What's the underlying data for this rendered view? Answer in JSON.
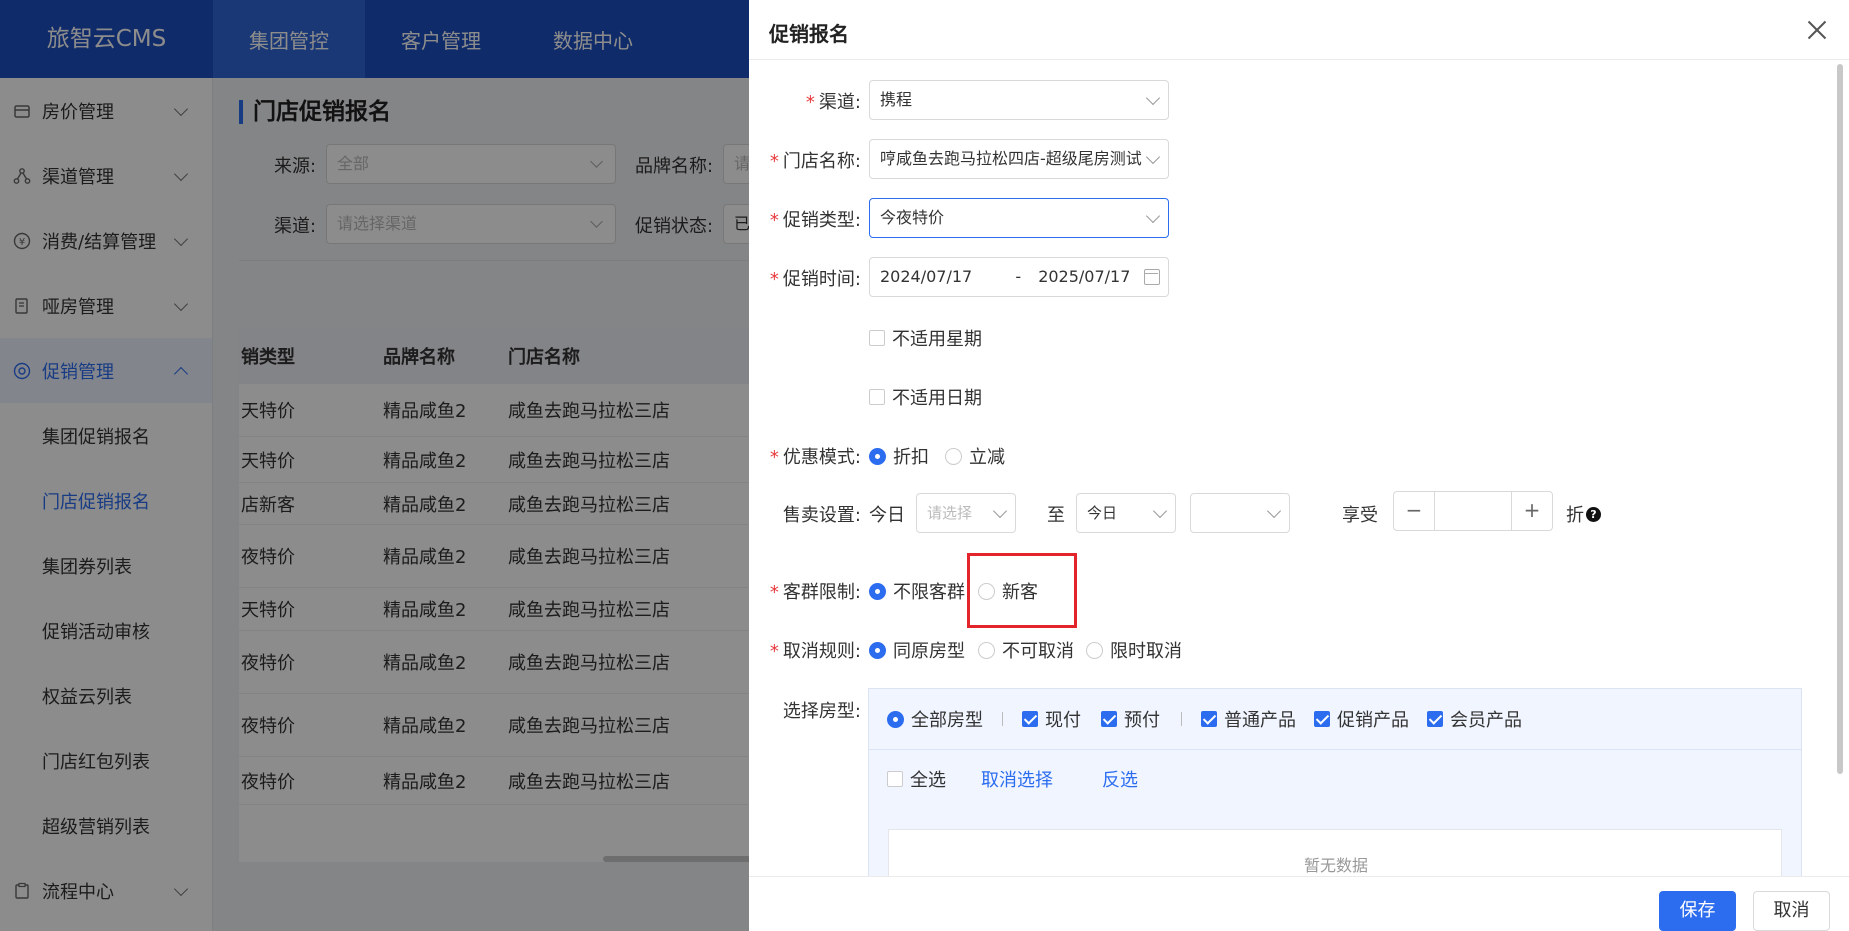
{
  "app": {
    "logo": "旅智云CMS"
  },
  "topnav": [
    "集团管控",
    "客户管理",
    "数据中心"
  ],
  "sidebar": {
    "items": [
      {
        "label": "房价管理"
      },
      {
        "label": "渠道管理"
      },
      {
        "label": "消费/结算管理"
      },
      {
        "label": "哑房管理"
      },
      {
        "label": "促销管理"
      }
    ],
    "sub_items": [
      "集团促销报名",
      "门店促销报名",
      "集团券列表",
      "促销活动审核",
      "权益云列表",
      "门店红包列表",
      "超级营销列表"
    ],
    "last_item": {
      "label": "流程中心"
    }
  },
  "main": {
    "title": "门店促销报名",
    "filters": {
      "source_label": "来源:",
      "source_value": "全部",
      "brand_label": "品牌名称:",
      "brand_value": "请",
      "channel_label": "渠道:",
      "channel_placeholder": "请选择渠道",
      "status_label": "促销状态:",
      "status_value": "已"
    },
    "table": {
      "headers": [
        "销类型",
        "品牌名称",
        "门店名称"
      ],
      "rows": [
        [
          "天特价",
          "精品咸鱼2",
          "咸鱼去跑马拉松三店"
        ],
        [
          "天特价",
          "精品咸鱼2",
          "咸鱼去跑马拉松三店"
        ],
        [
          "店新客",
          "精品咸鱼2",
          "咸鱼去跑马拉松三店"
        ],
        [
          "夜特价",
          "精品咸鱼2",
          "咸鱼去跑马拉松三店"
        ],
        [
          "天特价",
          "精品咸鱼2",
          "咸鱼去跑马拉松三店"
        ],
        [
          "夜特价",
          "精品咸鱼2",
          "咸鱼去跑马拉松三店"
        ],
        [
          "夜特价",
          "精品咸鱼2",
          "咸鱼去跑马拉松三店"
        ],
        [
          "夜特价",
          "精品咸鱼2",
          "咸鱼去跑马拉松三店"
        ]
      ]
    }
  },
  "drawer": {
    "title": "促销报名",
    "required_mark": "*",
    "channel": {
      "label": "渠道:",
      "value": "携程"
    },
    "store": {
      "label": "门店名称:",
      "value": "哼咸鱼去跑马拉松四店-超级尾房测试"
    },
    "promo_type": {
      "label": "促销类型:",
      "value": "今夜特价"
    },
    "promo_time": {
      "label": "促销时间:",
      "start": "2024/07/17",
      "separator": "-",
      "end": "2025/07/17"
    },
    "not_weekday": "不适用星期",
    "not_date": "不适用日期",
    "discount_mode": {
      "label": "优惠模式:",
      "options": [
        "折扣",
        "立减"
      ],
      "selected": "折扣"
    },
    "sale_setting": {
      "label": "售卖设置:",
      "today_text": "今日",
      "time_placeholder": "请选择",
      "to_text": "至",
      "end_day": "今日",
      "end_time": "",
      "enjoy_text": "享受",
      "minus": "−",
      "plus": "+",
      "value": "",
      "unit": "折",
      "help": "?"
    },
    "customer_limit": {
      "label": "客群限制:",
      "options": [
        "不限客群",
        "新客"
      ],
      "selected": "不限客群"
    },
    "cancel_rule": {
      "label": "取消规则:",
      "options": [
        "同原房型",
        "不可取消",
        "限时取消"
      ],
      "selected": "同原房型"
    },
    "room_type": {
      "label": "选择房型:",
      "all_room": "全部房型",
      "checks": [
        "现付",
        "预付",
        "普通产品",
        "促销产品",
        "会员产品"
      ],
      "select_all": "全选",
      "cancel_select": "取消选择",
      "invert": "反选",
      "empty": "暂无数据"
    },
    "footer": {
      "save": "保存",
      "cancel": "取消"
    }
  },
  "colors": {
    "primary": "#2c6df0",
    "topbar": "#1e4fbf",
    "highlight": "#e3242b"
  }
}
